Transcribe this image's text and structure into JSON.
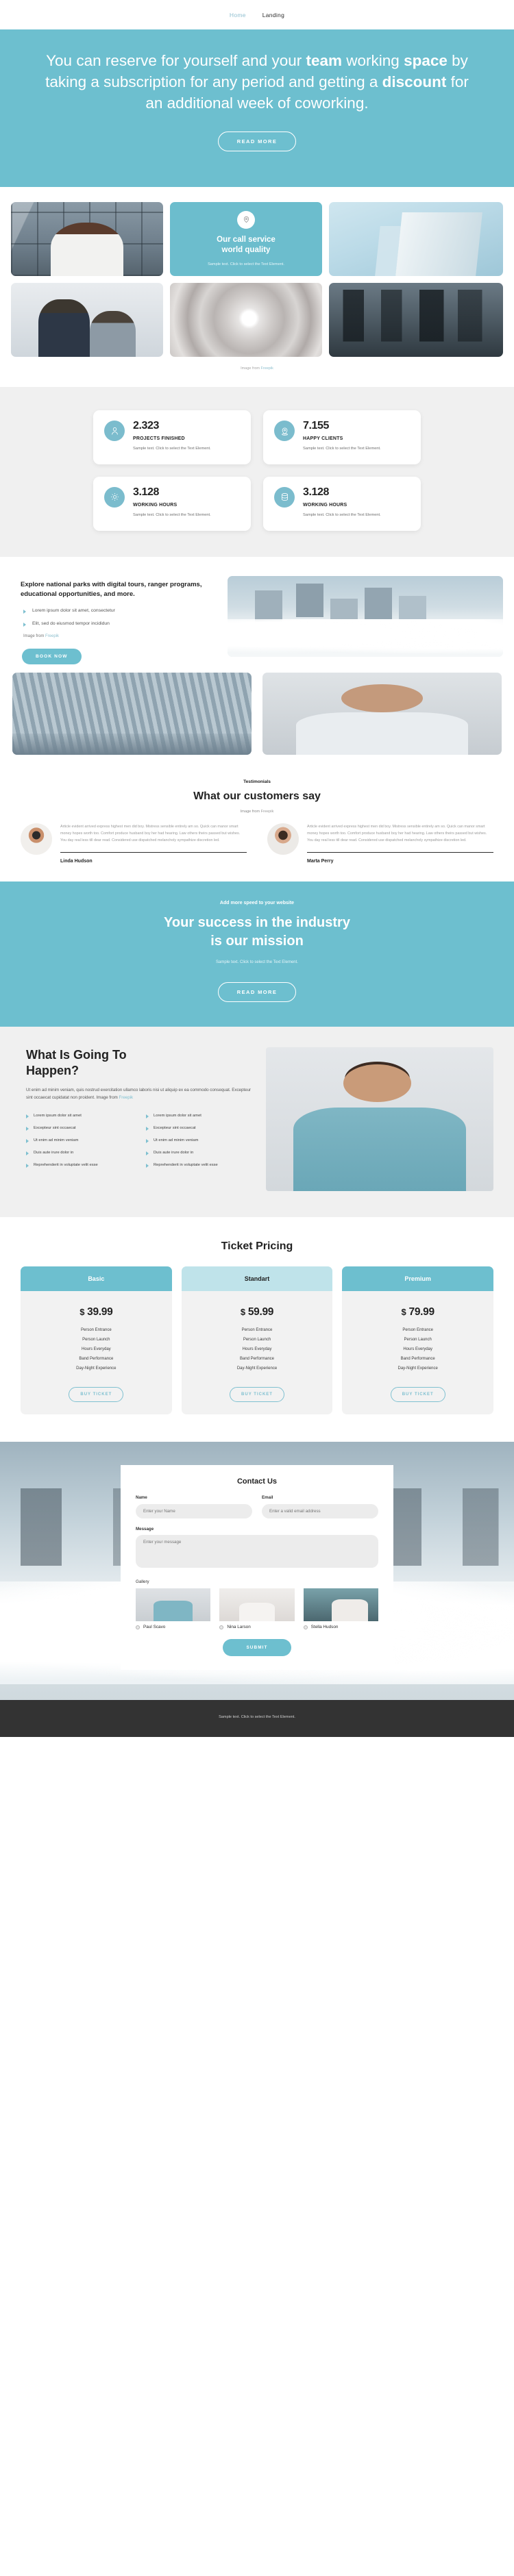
{
  "nav": {
    "items": [
      {
        "label": "Home",
        "active": false
      },
      {
        "label": "Landing",
        "active": true
      }
    ]
  },
  "hero": {
    "line1_a": "You can reserve for yourself and your ",
    "line1_b": "team",
    "line2_a": " working ",
    "line2_b": "space",
    "line2_c": " by taking a subscription for any period and getting a ",
    "line2_d": "discount",
    "line2_e": " for an additional week of coworking.",
    "button": "READ MORE"
  },
  "gallery": {
    "card": {
      "icon": "location-pin-icon",
      "title_line1": "Our call service",
      "title_line2": "world quality",
      "text": "Sample text. Click to select the Text Element."
    },
    "credit_prefix": "Image from ",
    "credit_link": "Freepik"
  },
  "stats": {
    "items": [
      {
        "icon": "user-icon",
        "number": "2.323",
        "label": "PROJECTS FINISHED",
        "text": "Sample text. Click to select the Text Element."
      },
      {
        "icon": "location-icon",
        "number": "7.155",
        "label": "HAPPY CLIENTS",
        "text": "Sample text. Click to select the Text Element."
      },
      {
        "icon": "gear-icon",
        "number": "3.128",
        "label": "WORKING HOURS",
        "text": "Sample text. Click to select the Text Element."
      },
      {
        "icon": "database-icon",
        "number": "3.128",
        "label": "WORKING HOURS",
        "text": "Sample text. Click to select the Text Element."
      }
    ]
  },
  "feature": {
    "heading": "Explore national parks with digital tours, ranger programs, educational opportunities, and more.",
    "bullets": [
      "Lorem ipsum dolor sit amet, consectetur",
      "Elit, sed do eiusmod tempor incididun"
    ],
    "credit_prefix": "Image from ",
    "credit_link": "Freepik",
    "button": "BOOK NOW"
  },
  "testimonials": {
    "eyebrow": "Testimonials",
    "heading": "What our customers say",
    "credit_prefix": "Image from ",
    "credit_link": "Freepik",
    "items": [
      {
        "text": "Article evident arrived express highest men did boy. Mistress sensible entirely am so. Quick can manor smart money hopes worth too. Comfort produce husband boy her had hearing. Law others theirs passed but wishes. You day real less till dear read. Considered use dispatched melancholy sympathize discretion led.",
        "name": "Linda Hudson"
      },
      {
        "text": "Article evident arrived express highest men did boy. Mistress sensible entirely am so. Quick can manor smart money hopes worth too. Comfort produce husband boy her had hearing. Law others theirs passed but wishes. You day real less till dear read. Considered use dispatched melancholy sympathize discretion led.",
        "name": "Marta Perry"
      }
    ]
  },
  "cta": {
    "eyebrow": "Add more speed to your website",
    "heading_line1": "Your success in the industry",
    "heading_line2": "is our mission",
    "sub": "Sample text. Click to select the Text Element.",
    "button": "READ MORE"
  },
  "happen": {
    "heading_line1": "What Is Going To",
    "heading_line2": "Happen?",
    "desc_text": "Ut enim ad minim veniam, quis nostrud exercitation ullamco laboris nisi ut aliquip ex ea commodo consequat. Excepteur sint occaecat cupidatat non proident. Image from ",
    "desc_link": "Freepik",
    "col_left": [
      "Lorem ipsum dolor sit amet",
      "Excepteur sint occaecat",
      "Ut enim ad minim veniam",
      "Duis aute irure dolor in",
      "Reprehenderit in voluptate velit esse"
    ],
    "col_right": [
      "Lorem ipsum dolor sit amet",
      "Excepteur sint occaecat",
      "Ut enim ad minim veniam",
      "Duis aute irure dolor in",
      "Reprehenderit in voluptate velit esse"
    ]
  },
  "pricing": {
    "heading": "Ticket Pricing",
    "plans": [
      {
        "name": "Basic",
        "currency": "$",
        "amount": "39.99",
        "head_bg": "#6dbfcf",
        "head_color": "#ffffff",
        "features": [
          "Person Entrance",
          "Person Launch",
          "Hours Everyday",
          "Band Performance",
          "Day-Night Experience"
        ],
        "button": "BUY TICKET"
      },
      {
        "name": "Standart",
        "currency": "$",
        "amount": "59.99",
        "head_bg": "#bfe3ea",
        "head_color": "#1f1f1f",
        "features": [
          "Person Entrance",
          "Person Launch",
          "Hours Everyday",
          "Band Performance",
          "Day-Night Experience"
        ],
        "button": "BUY TICKET"
      },
      {
        "name": "Premium",
        "currency": "$",
        "amount": "79.99",
        "head_bg": "#6dbfcf",
        "head_color": "#ffffff",
        "features": [
          "Person Entrance",
          "Person Launch",
          "Hours Everyday",
          "Band Performance",
          "Day-Night Experience"
        ],
        "button": "BUY TICKET"
      }
    ]
  },
  "contact": {
    "heading": "Contact Us",
    "name_label": "Name",
    "name_placeholder": "Enter your Name",
    "email_label": "Email",
    "email_placeholder": "Enter a valid email address",
    "message_label": "Message",
    "message_placeholder": "Enter your message",
    "gallery_label": "Gallery",
    "gallery_options": [
      {
        "name": "Paul Scavo"
      },
      {
        "name": "Nina Larson"
      },
      {
        "name": "Stella Hudson"
      }
    ],
    "submit": "SUBMIT"
  },
  "footer": {
    "text": "Sample text. Click to select the Text Element."
  },
  "colors": {
    "accent": "#6dbfcf",
    "accent_light": "#bfe3ea",
    "grey_bg": "#f0f0f0",
    "footer_bg": "#333333"
  }
}
